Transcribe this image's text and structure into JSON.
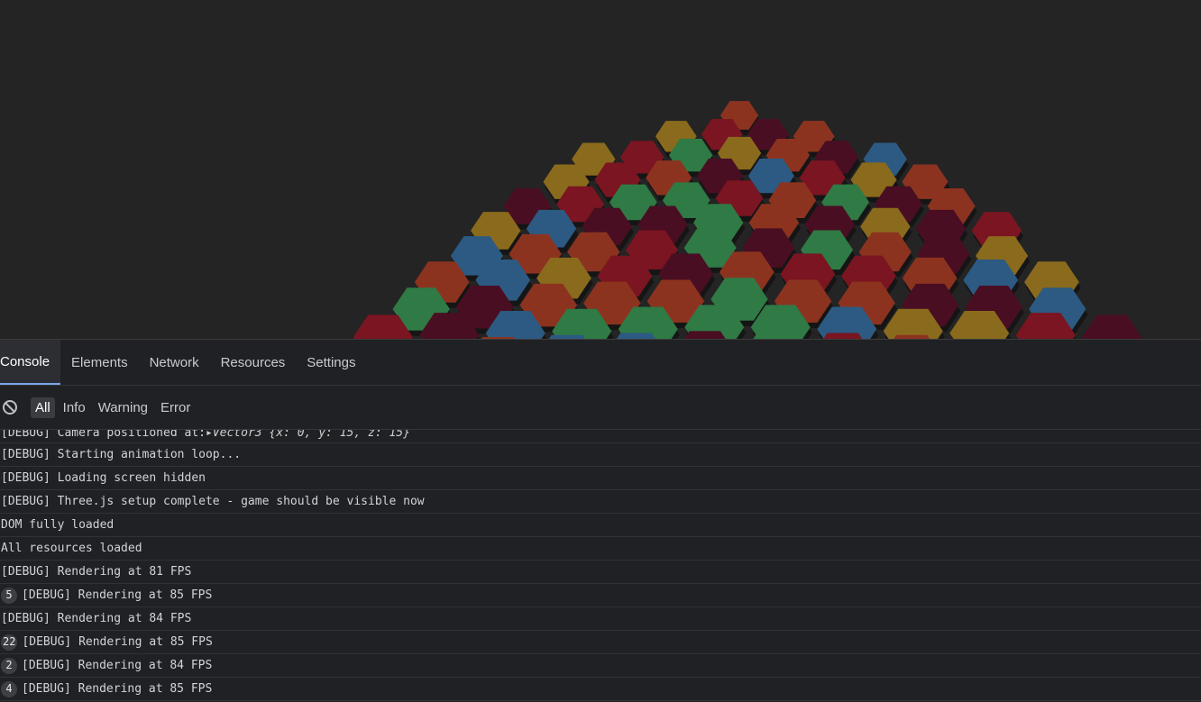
{
  "devtools": {
    "tabs": [
      "Console",
      "Elements",
      "Network",
      "Resources",
      "Settings"
    ],
    "active_tab": "Console",
    "filters": [
      "All",
      "Info",
      "Warning",
      "Error"
    ],
    "active_filter": "All",
    "first_row": {
      "text": "[DEBUG] Camera positioned at: ",
      "object_label": "▸Vector3 {x: 0, y: 15, z: 15}"
    },
    "log": [
      {
        "count": "",
        "text": "[DEBUG] Starting animation loop..."
      },
      {
        "count": "",
        "text": "[DEBUG] Loading screen hidden"
      },
      {
        "count": "",
        "text": "[DEBUG] Three.js setup complete - game should be visible now"
      },
      {
        "count": "",
        "text": "DOM fully loaded"
      },
      {
        "count": "",
        "text": "All resources loaded"
      },
      {
        "count": "",
        "text": "[DEBUG] Rendering at 81 FPS"
      },
      {
        "count": "5",
        "text": "[DEBUG] Rendering at 85 FPS"
      },
      {
        "count": "",
        "text": "[DEBUG] Rendering at 84 FPS"
      },
      {
        "count": "22",
        "text": "[DEBUG] Rendering at 85 FPS"
      },
      {
        "count": "2",
        "text": "[DEBUG] Rendering at 84 FPS"
      },
      {
        "count": "4",
        "text": "[DEBUG] Rendering at 85 FPS"
      }
    ]
  },
  "game": {
    "palette": {
      "red": "#7a1521",
      "maroon": "#4a0e22",
      "orange": "#8c3320",
      "yellow": "#8a6a1c",
      "blue": "#2c5a82",
      "green": "#2f7a45"
    },
    "background": "#242424"
  }
}
